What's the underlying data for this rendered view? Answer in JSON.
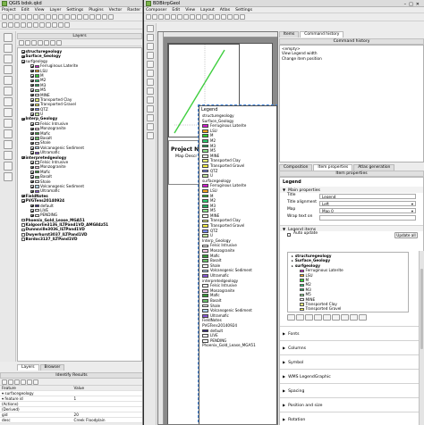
{
  "qgis": {
    "title": "QGIS bdsk.qkd",
    "menu": [
      "Project",
      "Edit",
      "View",
      "Layer",
      "Settings",
      "Plugins",
      "Vector",
      "Raster"
    ],
    "layers_panel_title": "Layers",
    "layers": [
      {
        "label": "structuregeology",
        "bold": true,
        "level": 1,
        "checked": true
      },
      {
        "label": "Surface_Geology",
        "bold": true,
        "level": 1,
        "checked": true
      },
      {
        "label": "surfgeology",
        "bold": false,
        "level": 1,
        "checked": true
      },
      {
        "label": "Ferruginous Laterite",
        "level": 2,
        "swatch": "#d11fd1"
      },
      {
        "label": "LSU",
        "level": 2,
        "swatch": "#f5a623"
      },
      {
        "label": "M",
        "level": 2,
        "swatch": "#33cc33"
      },
      {
        "label": "M2",
        "level": 2,
        "swatch": "#2ecc71"
      },
      {
        "label": "M3",
        "level": 2,
        "swatch": "#27ae60"
      },
      {
        "label": "M5",
        "level": 2,
        "swatch": "#8fe08f"
      },
      {
        "label": "MINE",
        "level": 2,
        "swatch": "#ffffff"
      },
      {
        "label": "Transported Clay",
        "level": 2,
        "swatch": "#e8f27a"
      },
      {
        "label": "Transported Gravel",
        "level": 2,
        "swatch": "#f7f04a"
      },
      {
        "label": "QTZ",
        "level": 2,
        "swatch": "#7b8cf0"
      },
      {
        "label": "U",
        "level": 2,
        "swatch": "#c3e6a3"
      },
      {
        "label": "Interp_Geology",
        "bold": true,
        "level": 1,
        "checked": true
      },
      {
        "label": "Felsic Intrusive",
        "level": 2,
        "swatch": "#ffffff"
      },
      {
        "label": "Monzogranite",
        "level": 2,
        "swatch": "#f3c9e6"
      },
      {
        "label": "Mafic",
        "level": 2,
        "swatch": "#3a9a3a"
      },
      {
        "label": "Basalt",
        "level": 2,
        "swatch": "#6bbf6b"
      },
      {
        "label": "Shale",
        "level": 2,
        "swatch": "#ffffff"
      },
      {
        "label": "Volcanogenic Sediment",
        "level": 2,
        "swatch": "#b2d6f2"
      },
      {
        "label": "Ultramafic",
        "level": 2,
        "swatch": "#8a5ad6"
      },
      {
        "label": "interpretedgeology",
        "bold": true,
        "level": 1,
        "checked": true
      },
      {
        "label": "Felsic Intrusive",
        "level": 2,
        "swatch": "#ffffff"
      },
      {
        "label": "Monzogranite",
        "level": 2,
        "swatch": "#f3c9e6"
      },
      {
        "label": "Mafic",
        "level": 2,
        "swatch": "#3a9a3a"
      },
      {
        "label": "Basalt",
        "level": 2,
        "swatch": "#6bbf6b"
      },
      {
        "label": "Shale",
        "level": 2,
        "swatch": "#ffffff"
      },
      {
        "label": "Volcanogenic Sediment",
        "level": 2,
        "swatch": "#b2d6f2"
      },
      {
        "label": "Ultramafic",
        "level": 2,
        "swatch": "#8a5ad6"
      },
      {
        "label": "FieldNotes",
        "bold": true,
        "level": 1,
        "checked": true
      },
      {
        "label": "PVGTens20140924",
        "bold": true,
        "level": 1,
        "checked": true
      },
      {
        "label": "default",
        "level": 2,
        "swatch": "#3b2f8a"
      },
      {
        "label": "LIVE",
        "level": 2,
        "swatch": "#ffffff"
      },
      {
        "label": "PENDING",
        "level": 2,
        "swatch": "#ffffff"
      },
      {
        "label": "Phoenix_Gold_Lease_MGA51",
        "bold": true,
        "level": 1,
        "checked": false
      },
      {
        "label": "Kalgoorlie3136_ILTPand1VD_AMG84z51",
        "bold": true,
        "level": 1,
        "checked": false
      },
      {
        "label": "Dunnsville3036_ILTPand1VD",
        "bold": true,
        "level": 1,
        "checked": false
      },
      {
        "label": "Dwyerhurst3037_ILTPand1VD",
        "bold": true,
        "level": 1,
        "checked": false
      },
      {
        "label": "Bardoc3137_ILTPand1VD",
        "bold": true,
        "level": 1,
        "checked": false
      }
    ],
    "bottom_tabs": [
      "Layers",
      "Browser"
    ],
    "identify": {
      "title": "Identify Results",
      "headers": [
        "Feature",
        "Value"
      ],
      "rows": [
        [
          "▾ surfacegeology",
          ""
        ],
        [
          "  ▾ feature id",
          "1"
        ],
        [
          "    (Actions)",
          ""
        ],
        [
          "    (Derived)",
          ""
        ],
        [
          "    gid",
          "20"
        ],
        [
          "    desc",
          "Creek Floodplain"
        ]
      ]
    }
  },
  "composer": {
    "title": "BDBkrpGeol",
    "menu": [
      "Composer",
      "Edit",
      "View",
      "Layout",
      "Atlas",
      "Settings"
    ],
    "right_top_tabs": [
      "Items",
      "Command history"
    ],
    "command_history_title": "Command history",
    "commands": [
      "<empty>",
      "View Legend width",
      "Change item position"
    ],
    "legend_title": "Legend",
    "page_title": "Project Na",
    "page_subtitle": "Map Descr",
    "legend_groups": [
      {
        "label": "structuregeology",
        "items": []
      },
      {
        "label": "Surface_Geology",
        "items": []
      },
      {
        "label": "",
        "items": [
          {
            "label": "Ferruginous Laterite",
            "swatch": "#d11fd1"
          },
          {
            "label": "LSU",
            "swatch": "#f5a623"
          },
          {
            "label": "M",
            "swatch": "#33cc33"
          },
          {
            "label": "M2",
            "swatch": "#2ecc71"
          },
          {
            "label": "M3",
            "swatch": "#27ae60"
          },
          {
            "label": "M5",
            "swatch": "#8fe08f"
          },
          {
            "label": "MINE",
            "swatch": "#ffffff"
          },
          {
            "label": "Transported Clay",
            "swatch": "#e8f27a"
          },
          {
            "label": "Transported Gravel",
            "swatch": "#f7f04a"
          },
          {
            "label": "QTZ",
            "swatch": "#7b8cf0"
          },
          {
            "label": "U",
            "swatch": "#c3e6a3"
          }
        ]
      },
      {
        "label": "surfacegeology",
        "items": [
          {
            "label": "Ferruginous Laterite",
            "swatch": "#d11fd1"
          },
          {
            "label": "LSU",
            "swatch": "#f5a623"
          },
          {
            "label": "M",
            "swatch": "#33cc33"
          },
          {
            "label": "M2",
            "swatch": "#2ecc71"
          },
          {
            "label": "M3",
            "swatch": "#27ae60"
          },
          {
            "label": "M5",
            "swatch": "#8fe08f"
          },
          {
            "label": "MINE",
            "swatch": "#ffffff"
          },
          {
            "label": "Transported Clay",
            "swatch": "#e8f27a"
          },
          {
            "label": "Transported Gravel",
            "swatch": "#f7f04a"
          },
          {
            "label": "QTZ",
            "swatch": "#7b8cf0"
          },
          {
            "label": "U",
            "swatch": "#c3e6a3"
          }
        ]
      },
      {
        "label": "Interp_Geology",
        "items": [
          {
            "label": "Felsic Intrusive",
            "swatch": "#ffffff"
          },
          {
            "label": "Monzogranite",
            "swatch": "#f3c9e6"
          },
          {
            "label": "Mafic",
            "swatch": "#3a9a3a"
          },
          {
            "label": "Basalt",
            "swatch": "#6bbf6b"
          },
          {
            "label": "Shale",
            "swatch": "#ffffff"
          },
          {
            "label": "Volcanogenic Sediment",
            "swatch": "#b2d6f2"
          },
          {
            "label": "Ultramafic",
            "swatch": "#8a5ad6"
          }
        ]
      },
      {
        "label": "interpretedgeology",
        "items": [
          {
            "label": "Felsic Intrusive",
            "swatch": "#ffffff"
          },
          {
            "label": "Monzogranite",
            "swatch": "#f3c9e6"
          },
          {
            "label": "Mafic",
            "swatch": "#3a9a3a"
          },
          {
            "label": "Basalt",
            "swatch": "#6bbf6b"
          },
          {
            "label": "Shale",
            "swatch": "#ffffff"
          },
          {
            "label": "Volcanogenic Sediment",
            "swatch": "#b2d6f2"
          },
          {
            "label": "Ultramafic",
            "swatch": "#8a5ad6"
          }
        ]
      },
      {
        "label": "FieldNotes",
        "items": []
      },
      {
        "label": "PVGTens20140924",
        "items": [
          {
            "label": "default",
            "swatch": "#3b2f8a"
          },
          {
            "label": "LIVE",
            "swatch": "#ffffff"
          },
          {
            "label": "PENDING",
            "swatch": "#ffffff"
          }
        ]
      },
      {
        "label": "Phoenix_Gold_Lease_MGA51",
        "items": []
      }
    ],
    "props_tabs": [
      "Composition",
      "Item properties",
      "Atlas generation"
    ],
    "item_props_title": "Item properties",
    "legend_header": "Legend",
    "main_properties": {
      "label": "Main properties",
      "title_label": "Title",
      "title_value": "Legend",
      "title_alignment_label": "Title alignment",
      "title_alignment_value": "Left",
      "map_label": "Map",
      "map_value": "Map 0",
      "wrap_label": "Wrap text on",
      "wrap_value": ""
    },
    "legend_items_label": "Legend items",
    "auto_update_label": "Auto update",
    "update_all_label": "Update all",
    "legend_tree": [
      {
        "label": "structuregeology",
        "level": 1
      },
      {
        "label": "Surface_Geology",
        "level": 1
      },
      {
        "label": "surfgeology",
        "level": 1
      },
      {
        "label": "Ferruginous Laterite",
        "level": 2,
        "swatch": "#d11fd1"
      },
      {
        "label": "LSU",
        "level": 2,
        "swatch": "#f5a623"
      },
      {
        "label": "M",
        "level": 2,
        "swatch": "#33cc33"
      },
      {
        "label": "M2",
        "level": 2,
        "swatch": "#2ecc71"
      },
      {
        "label": "M3",
        "level": 2,
        "swatch": "#27ae60"
      },
      {
        "label": "M5",
        "level": 2,
        "swatch": "#8fe08f"
      },
      {
        "label": "MINE",
        "level": 2,
        "swatch": "#ffffff"
      },
      {
        "label": "Transported Clay",
        "level": 2,
        "swatch": "#e8f27a"
      },
      {
        "label": "Transported Gravel",
        "level": 2,
        "swatch": "#f7f04a"
      }
    ],
    "sections": [
      "Fonts",
      "Columns",
      "Symbol",
      "WMS LegendGraphic",
      "Spacing",
      "Position and size",
      "Rotation",
      "Frame"
    ]
  }
}
